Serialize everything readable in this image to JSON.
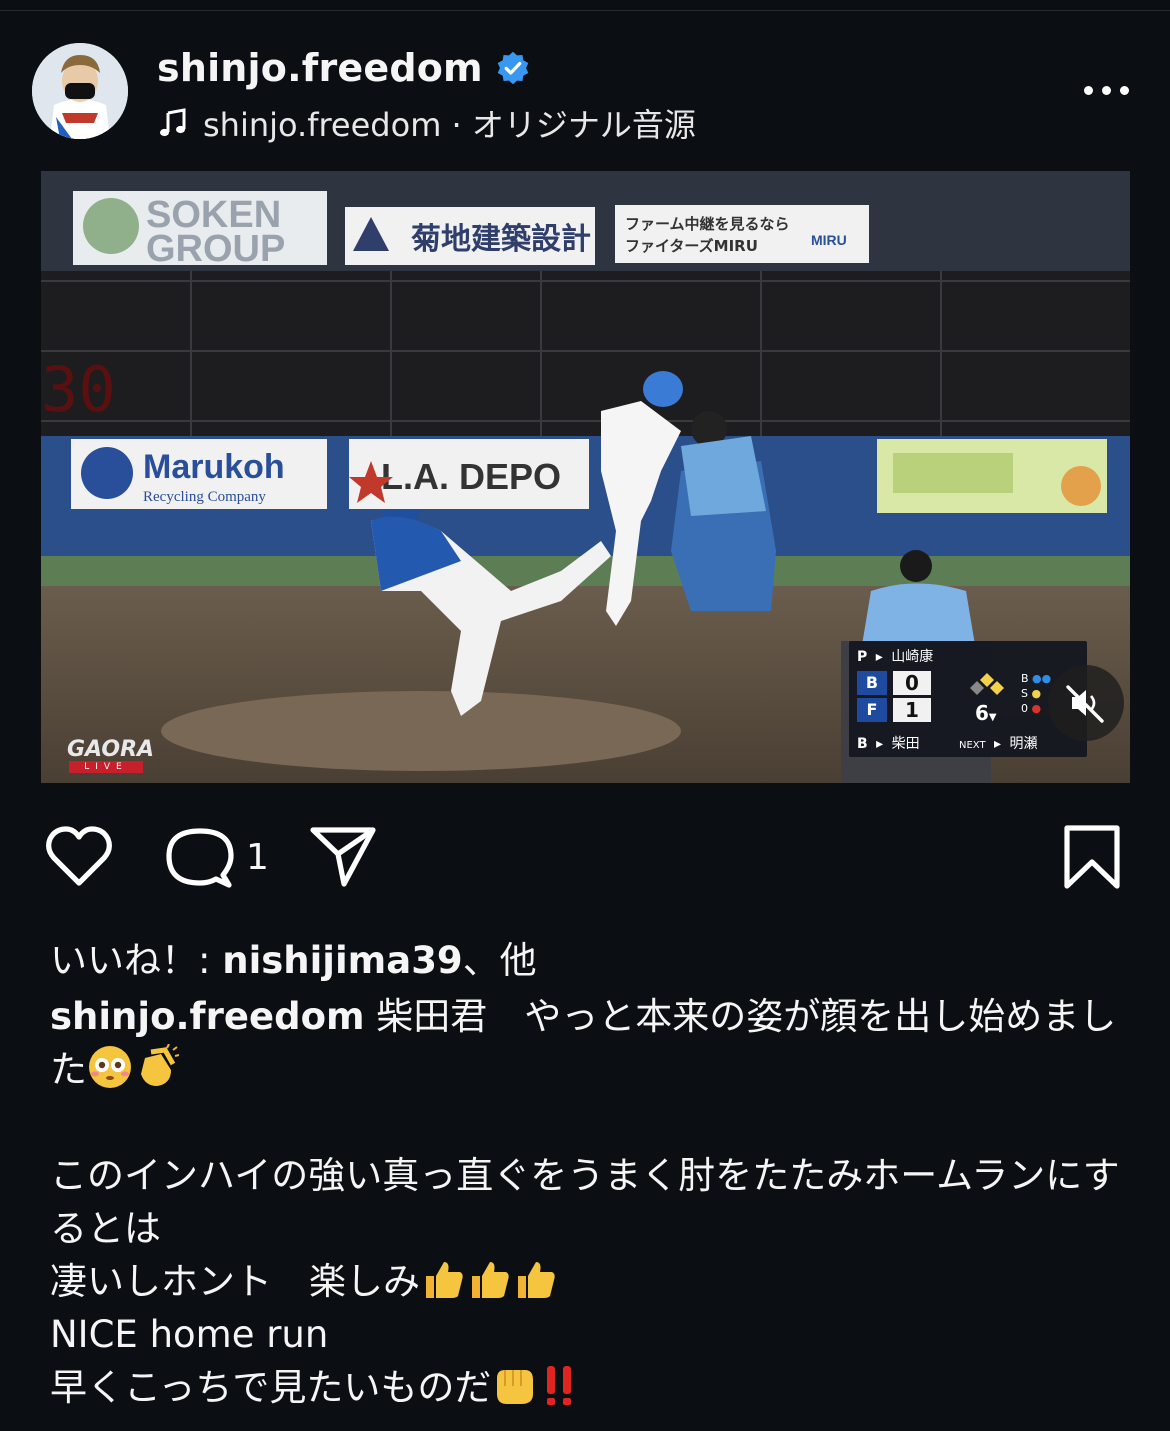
{
  "post": {
    "username": "shinjo.freedom",
    "audio_text": "shinjo.freedom · オリジナル音源"
  },
  "video": {
    "sign_soken": "SOKEN GROUP",
    "sign_kikuchi": "菊地建築設計",
    "sign_miru": "ファーム中継を見るなら ファイターズMIRU",
    "sign_marukoh": "Marukoh",
    "sign_marukoh_sub": "Recycling Company",
    "sign_la_depo": "L.A. DEPO",
    "broadcaster": "GAORA",
    "broadcaster_sub": "LIVE",
    "scoreboard": {
      "pitcher_label": "P",
      "pitcher": "山崎康",
      "team1": "B",
      "team1_score": "0",
      "team2": "F",
      "team2_score": "1",
      "inning": "6",
      "count_b": "B",
      "count_s": "S",
      "outs": "0",
      "batter_label": "B",
      "batter": "柴田",
      "next_label": "NEXT",
      "next": "明瀬"
    }
  },
  "actions": {
    "comment_count": "1"
  },
  "likes": {
    "prefix": "いいね！: ",
    "user": "nishijima39",
    "suffix": "、他"
  },
  "caption": {
    "username": "shinjo.freedom",
    "line1": " 柴田君　やっと本来の姿が顔を出し始めました",
    "line2": "このインハイの強い真っ直ぐをうまく肘をたたみホームランにするとは",
    "line3": "凄いしホント　楽しみ",
    "line4": "NICE home run",
    "line5": "早くこっちで見たいものだ"
  },
  "icons": {
    "verified": "verified-badge-icon",
    "music": "music-note-icon",
    "more": "more-options-icon",
    "like": "heart-icon",
    "comment": "comment-icon",
    "share": "send-icon",
    "save": "bookmark-icon",
    "mute": "speaker-muted-icon"
  },
  "colors": {
    "background": "#0b0f14",
    "verified": "#3897f0",
    "text": "#f5f5f5"
  }
}
